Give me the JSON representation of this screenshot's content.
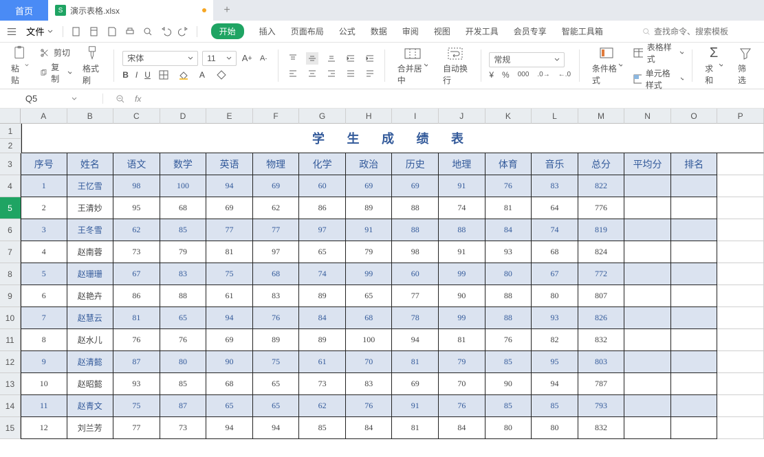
{
  "tabs": {
    "home": "首页",
    "file": "演示表格.xlsx"
  },
  "file_button": "文件",
  "menu": {
    "start": "开始",
    "insert": "插入",
    "layout": "页面布局",
    "formula": "公式",
    "data": "数据",
    "review": "审阅",
    "view": "视图",
    "dev": "开发工具",
    "vip": "会员专享",
    "smart": "智能工具箱"
  },
  "search_ph": "查找命令、搜索模板",
  "clip": {
    "paste": "粘贴",
    "cut": "剪切",
    "copy": "复制",
    "painter": "格式刷"
  },
  "font": {
    "name": "宋体",
    "size": "11"
  },
  "merge": "合并居中",
  "wrap": "自动换行",
  "numfmt": "常规",
  "pct": "%",
  "cond": "条件格式",
  "tstyle": "表格样式",
  "cstyle": "单元格样式",
  "sum": "求和",
  "filter": "筛选",
  "namebox": "Q5",
  "fx": "fx",
  "cols": [
    "A",
    "B",
    "C",
    "D",
    "E",
    "F",
    "G",
    "H",
    "I",
    "J",
    "K",
    "L",
    "M",
    "N",
    "O",
    "P"
  ],
  "title": "学 生 成 绩 表",
  "headers": [
    "序号",
    "姓名",
    "语文",
    "数学",
    "英语",
    "物理",
    "化学",
    "政治",
    "历史",
    "地理",
    "体育",
    "音乐",
    "总分",
    "平均分",
    "排名"
  ],
  "data": [
    [
      "1",
      "王忆雪",
      "98",
      "100",
      "94",
      "69",
      "60",
      "69",
      "69",
      "91",
      "76",
      "83",
      "822",
      "",
      ""
    ],
    [
      "2",
      "王清妙",
      "95",
      "68",
      "69",
      "62",
      "86",
      "89",
      "88",
      "74",
      "81",
      "64",
      "776",
      "",
      ""
    ],
    [
      "3",
      "王冬雪",
      "62",
      "85",
      "77",
      "77",
      "97",
      "91",
      "88",
      "88",
      "84",
      "74",
      "819",
      "",
      ""
    ],
    [
      "4",
      "赵南蓉",
      "73",
      "79",
      "81",
      "97",
      "65",
      "79",
      "98",
      "91",
      "93",
      "68",
      "824",
      "",
      ""
    ],
    [
      "5",
      "赵珊珊",
      "67",
      "83",
      "75",
      "68",
      "74",
      "99",
      "60",
      "99",
      "80",
      "67",
      "772",
      "",
      ""
    ],
    [
      "6",
      "赵艳卉",
      "86",
      "88",
      "61",
      "83",
      "89",
      "65",
      "77",
      "90",
      "88",
      "80",
      "807",
      "",
      ""
    ],
    [
      "7",
      "赵慧云",
      "81",
      "65",
      "94",
      "76",
      "84",
      "68",
      "78",
      "99",
      "88",
      "93",
      "826",
      "",
      ""
    ],
    [
      "8",
      "赵水儿",
      "76",
      "76",
      "69",
      "89",
      "89",
      "100",
      "94",
      "81",
      "76",
      "82",
      "832",
      "",
      ""
    ],
    [
      "9",
      "赵清懿",
      "87",
      "80",
      "90",
      "75",
      "61",
      "70",
      "81",
      "79",
      "85",
      "95",
      "803",
      "",
      ""
    ],
    [
      "10",
      "赵昭懿",
      "93",
      "85",
      "68",
      "65",
      "73",
      "83",
      "69",
      "70",
      "90",
      "94",
      "787",
      "",
      ""
    ],
    [
      "11",
      "赵青文",
      "75",
      "87",
      "65",
      "65",
      "62",
      "76",
      "91",
      "76",
      "85",
      "85",
      "793",
      "",
      ""
    ],
    [
      "12",
      "刘兰芳",
      "77",
      "73",
      "94",
      "94",
      "85",
      "84",
      "81",
      "84",
      "80",
      "80",
      "832",
      "",
      ""
    ]
  ]
}
